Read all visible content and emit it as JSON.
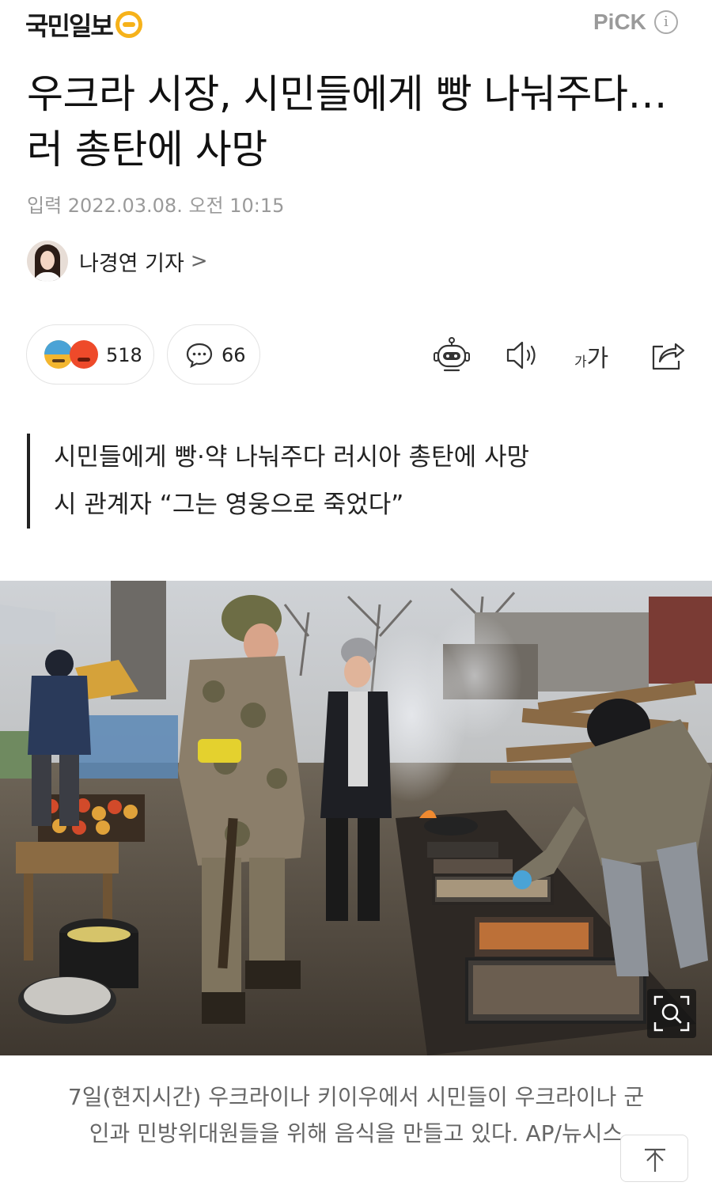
{
  "header": {
    "logo_text": "국민일보",
    "pick_label": "PiCK",
    "info_label": "i"
  },
  "article": {
    "title": "우크라 시장, 시민들에게 빵 나눠주다…러 총탄에 사망",
    "date": "입력 2022.03.08. 오전 10:15",
    "reporter": "나경연 기자",
    "reporter_chevron": ">"
  },
  "actions": {
    "reaction_count": "518",
    "comment_count": "66",
    "font_small": "가",
    "font_big": "가"
  },
  "summary": {
    "line1": "시민들에게 빵·약 나눠주다 러시아 총탄에 사망",
    "line2": "시 관계자 “그는 영웅으로 죽었다”"
  },
  "photo": {
    "caption_line1": "7일(현지시간) 우크라이나 키이우에서 시민들이 우크라이나 군",
    "caption_line2": "인과 민방위대원들을 위해 음식을 만들고 있다. AP/뉴시스"
  },
  "icons": {
    "logo_mark": "logo-circle-icon",
    "info": "info-icon",
    "reaction_sad": "sad-emoji-icon",
    "reaction_angry": "angry-emoji-icon",
    "comment": "comment-bubble-icon",
    "summary_bot": "robot-icon",
    "listen": "speaker-icon",
    "share": "share-icon",
    "zoom": "zoom-icon",
    "scroll_top": "arrow-up-icon"
  },
  "colors": {
    "logo_accent": "#f6b21a",
    "text_primary": "#111111",
    "text_secondary": "#9a9a9a",
    "border": "#e3e3e3"
  }
}
